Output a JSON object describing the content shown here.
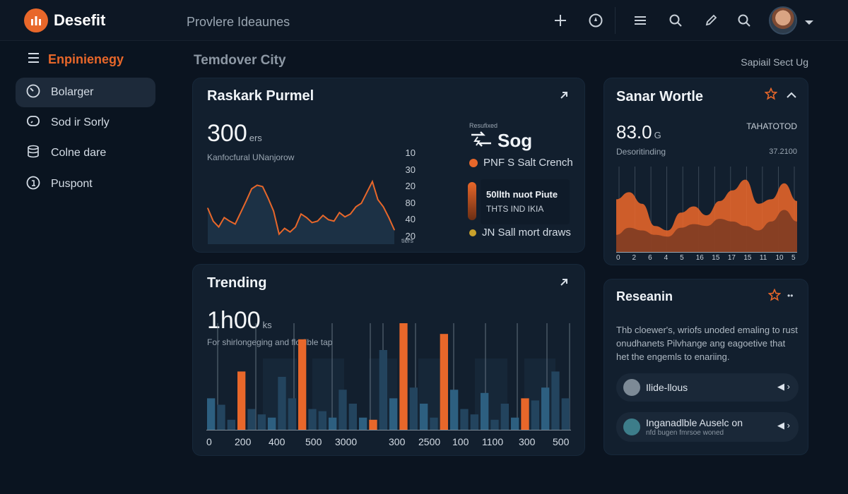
{
  "app": {
    "brand": "Desefit",
    "subtitle": "Provlere Ideaunes"
  },
  "sidebar": {
    "header": "Enpinienegy",
    "items": [
      {
        "label": "Bolarger",
        "active": true
      },
      {
        "label": "Sod ir Sorly",
        "active": false
      },
      {
        "label": "Colne dare",
        "active": false
      },
      {
        "label": "Puspont",
        "active": false
      }
    ]
  },
  "main": {
    "title": "Temdover City",
    "action": "Sapiail Sect Ug"
  },
  "card1": {
    "title": "Raskark Purmel",
    "value": "300",
    "unit": "ers",
    "caption": "Kanfocfural UNanjorow",
    "ticks": [
      "10",
      "30",
      "20",
      "80",
      "40",
      "20"
    ],
    "ticks_unit": "tiers",
    "legend_small": "Resufixed",
    "legend_big": "Sog",
    "legend_items": [
      "PNF S Salt Crench",
      "50llth nuot Piute",
      "THTS IND IKIA",
      "JN Sall mort draws"
    ]
  },
  "card2": {
    "title": "Sanar Wortle",
    "value": "83.0",
    "unit": "G",
    "caption": "Desoritinding",
    "right_top": "TAHATOTOD",
    "right_sub": "37.2100",
    "x_ticks": [
      "0",
      "2",
      "6",
      "4",
      "5",
      "16",
      "15",
      "17",
      "15",
      "11",
      "10",
      "5"
    ]
  },
  "card3": {
    "title": "Trending",
    "value": "1h00",
    "unit": "ks",
    "caption": "For shirlongeging and flodible tap",
    "x_ticks": [
      "0",
      "200",
      "400",
      "500",
      "3000",
      "300",
      "2500",
      "100",
      "1100",
      "300",
      "500"
    ]
  },
  "card4": {
    "title": "Reseanin",
    "text": "Thb cloewer's, wriofs unoded emaling to rust onudhanets Pilvhange ang eagoetive that het the engemls to enariing.",
    "items": [
      {
        "label": "Ilide-llous",
        "sub": ""
      },
      {
        "label": "Inganadlble Auselc on",
        "sub": "nfd bugen fmrsoe woned"
      }
    ]
  },
  "colors": {
    "accent": "#e8672a",
    "background": "#0b1420",
    "card": "#121f2e",
    "series_blue": "#2a5c7c"
  },
  "chart_data": [
    {
      "type": "line",
      "series": [
        {
          "values": [
            48,
            30,
            22,
            35,
            30,
            26,
            42,
            58,
            75,
            80,
            78,
            62,
            44,
            12,
            20,
            15,
            22,
            40,
            35,
            28,
            30,
            38,
            32,
            30,
            42,
            36,
            40,
            50,
            55,
            70,
            85,
            60,
            50,
            35,
            18
          ]
        }
      ]
    },
    {
      "type": "area",
      "x": [
        "0",
        "2",
        "6",
        "4",
        "5",
        "16",
        "15",
        "17",
        "15",
        "11",
        "10",
        "5"
      ],
      "series": [
        {
          "values": [
            60,
            68,
            55,
            30,
            25,
            45,
            52,
            42,
            58,
            70,
            82,
            55,
            60,
            78,
            58
          ]
        },
        {
          "values": [
            20,
            28,
            25,
            20,
            18,
            28,
            32,
            30,
            38,
            35,
            30,
            25,
            35,
            48,
            35
          ]
        }
      ]
    },
    {
      "type": "bar",
      "x": [
        "0",
        "200",
        "400",
        "500",
        "3000",
        "300",
        "2500",
        "100",
        "1100",
        "300",
        "500"
      ],
      "series": [
        {
          "values": [
            30,
            24,
            10,
            55,
            20,
            15,
            12,
            50,
            30,
            85,
            20,
            18,
            12,
            38,
            25,
            12,
            10,
            75,
            30,
            100,
            40,
            25,
            12,
            90,
            38,
            20,
            15,
            35,
            10,
            25,
            12,
            30,
            28,
            40,
            55,
            30
          ]
        }
      ]
    }
  ]
}
